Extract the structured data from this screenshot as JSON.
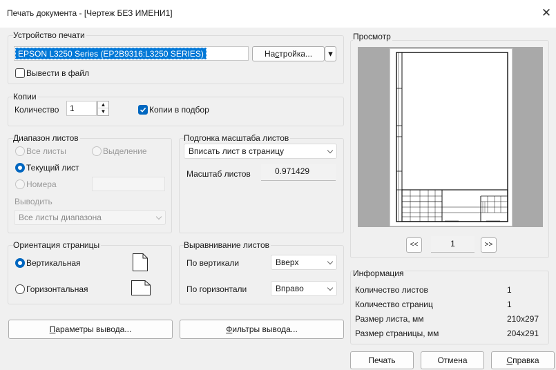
{
  "window": {
    "title": "Печать документа - [Чертеж БЕЗ ИМЕНИ1]",
    "close_glyph": "✕"
  },
  "printer": {
    "group_label": "Устройство печати",
    "device": "EPSON L3250 Series (EP2B9316:L3250 SERIES)",
    "setup_label_pre": "На",
    "setup_label_u": "с",
    "setup_label_post": "тройка...",
    "dropdown_glyph": "▾",
    "to_file_label": "Вывести в файл",
    "to_file_checked": false
  },
  "copies": {
    "group_label": "Копии",
    "count_label": "Количество",
    "count_value": "1",
    "collate_label": "Копии в подбор",
    "collate_checked": true
  },
  "range": {
    "group_label": "Диапазон листов",
    "all_label": "Все листы",
    "selection_label": "Выделение",
    "current_label": "Текущий лист",
    "numbers_label": "Номера",
    "numbers_value": "",
    "output_label": "Выводить",
    "output_value": "Все листы диапазона"
  },
  "scale": {
    "group_label": "Подгонка масштаба листов",
    "fit_value": "Вписать лист в страницу",
    "scale_label": "Масштаб листов",
    "scale_value": "0.971429"
  },
  "orientation": {
    "group_label": "Ориентация страницы",
    "portrait_label": "Вертикальная",
    "landscape_label": "Горизонтальная",
    "selected": "portrait"
  },
  "align": {
    "group_label": "Выравнивание листов",
    "vertical_label": "По вертикали",
    "vertical_value": "Вверх",
    "horizontal_label": "По горизонтали",
    "horizontal_value": "Вправо"
  },
  "buttons": {
    "output_params_pre": "",
    "output_params_u": "П",
    "output_params_post": "араметры вывода...",
    "output_filters_pre": "",
    "output_filters_u": "Ф",
    "output_filters_post": "ильтры вывода...",
    "print": "Печать",
    "cancel": "Отмена",
    "help_u": "С",
    "help_post": "правка"
  },
  "preview": {
    "group_label": "Просмотр",
    "prev_label": "<<",
    "page_value": "1",
    "next_label": ">>"
  },
  "info": {
    "group_label": "Информация",
    "rows": [
      {
        "label": "Количество листов",
        "value": "1"
      },
      {
        "label": "Количество страниц",
        "value": "1"
      },
      {
        "label": "Размер листа, мм",
        "value": "210x297"
      },
      {
        "label": "Размер страницы, мм",
        "value": "204x291"
      }
    ]
  },
  "colors": {
    "accent": "#0067c0",
    "selection": "#0078d7"
  }
}
